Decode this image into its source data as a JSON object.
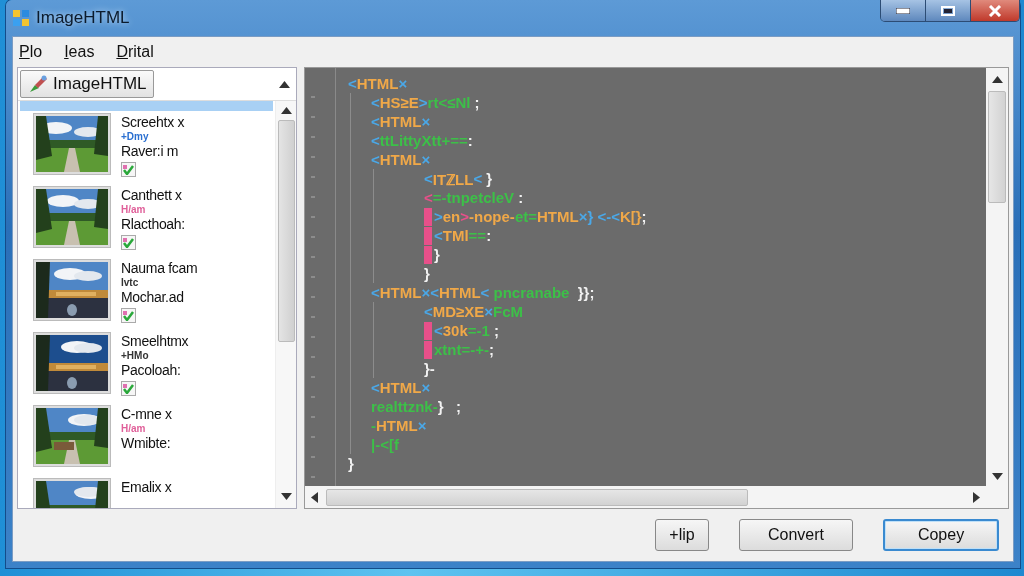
{
  "window": {
    "title": "ImageHTML"
  },
  "menu": [
    {
      "label": "Plo"
    },
    {
      "label": "Ieas"
    },
    {
      "label": "Drital"
    }
  ],
  "sidebar": {
    "header_button": "ImageHTML",
    "items": [
      {
        "title": "Screehtx x",
        "subtitle": {
          "text": "+Dmy",
          "color": "#2a6fd0"
        },
        "label": "Raver:i m",
        "checked": true
      },
      {
        "title": "Canthett x",
        "subtitle": {
          "text": "H/am",
          "color": "#e0609a"
        },
        "label": "Rlacthoah:",
        "checked": true
      },
      {
        "title": "Nauma fcam",
        "subtitle": {
          "text": "Ivtc",
          "color": "#333333"
        },
        "label": "Mochar.ad",
        "checked": true
      },
      {
        "title": "Smeelhtmx",
        "subtitle": {
          "text": "+HMo",
          "color": "#333333"
        },
        "label": "Pacoloah:",
        "checked": true
      },
      {
        "title": "C-mne x",
        "subtitle": {
          "text": "H/am",
          "color": "#e0609a"
        },
        "label": "Wmibte:"
      },
      {
        "title": "Emalix x"
      }
    ]
  },
  "code": {
    "lines": [
      {
        "segments": [
          {
            "text": "<",
            "kind": "br"
          },
          {
            "text": "HTML",
            "kind": "tag"
          },
          {
            "text": "×",
            "kind": "br"
          }
        ],
        "children": [
          {
            "segments": [
              {
                "text": "<",
                "kind": "br"
              },
              {
                "text": "HS≥E",
                "kind": "tag"
              },
              {
                "text": ">",
                "kind": "br"
              },
              {
                "text": "rt<≤Nl",
                "kind": "val"
              },
              {
                "text": " ;",
                "kind": "pun"
              }
            ]
          },
          {
            "segments": [
              {
                "text": "<",
                "kind": "br"
              },
              {
                "text": "HTML",
                "kind": "tag"
              },
              {
                "text": "×",
                "kind": "br"
              }
            ]
          },
          {
            "segments": [
              {
                "text": "<",
                "kind": "br"
              },
              {
                "text": "ttLittyXtt+==",
                "kind": "val"
              },
              {
                "text": ":",
                "kind": "pun"
              }
            ]
          },
          {
            "segments": [
              {
                "text": "<",
                "kind": "br"
              },
              {
                "text": "HTML",
                "kind": "tag"
              },
              {
                "text": "×",
                "kind": "br"
              }
            ],
            "children": [
              {
                "segments": [
                  {
                    "text": "<",
                    "kind": "br"
                  },
                  {
                    "text": "ITℤLL",
                    "kind": "tag"
                  },
                  {
                    "text": "<",
                    "kind": "br"
                  },
                  {
                    "text": " }",
                    "kind": "pun"
                  }
                ]
              },
              {
                "segments": [
                  {
                    "text": "<",
                    "kind": "mk"
                  },
                  {
                    "text": "=-tnpetcleV",
                    "kind": "val"
                  },
                  {
                    "text": " :",
                    "kind": "pun"
                  }
                ]
              },
              {
                "marker": true,
                "segments": [
                  {
                    "text": ">",
                    "kind": "br"
                  },
                  {
                    "text": "en",
                    "kind": "tag"
                  },
                  {
                    "text": ">",
                    "kind": "mk"
                  },
                  {
                    "text": "-nope-",
                    "kind": "tag"
                  },
                  {
                    "text": "et=",
                    "kind": "val"
                  },
                  {
                    "text": "HTML",
                    "kind": "tag"
                  },
                  {
                    "text": "×}",
                    "kind": "br"
                  },
                  {
                    "text": " <-<",
                    "kind": "br"
                  },
                  {
                    "text": "K[}",
                    "kind": "tag"
                  },
                  {
                    "text": ";",
                    "kind": "pun"
                  }
                ]
              },
              {
                "marker": true,
                "segments": [
                  {
                    "text": "<",
                    "kind": "br"
                  },
                  {
                    "text": "TMl",
                    "kind": "tag"
                  },
                  {
                    "text": "==",
                    "kind": "val"
                  },
                  {
                    "text": ":",
                    "kind": "pun"
                  }
                ]
              },
              {
                "marker": true,
                "segments": [
                  {
                    "text": "}",
                    "kind": "pun"
                  }
                ]
              },
              {
                "segments": [
                  {
                    "text": "}",
                    "kind": "pun"
                  }
                ]
              }
            ]
          },
          {
            "segments": [
              {
                "text": "<",
                "kind": "br"
              },
              {
                "text": "HTML",
                "kind": "tag"
              },
              {
                "text": "×<",
                "kind": "br"
              },
              {
                "text": "HTML",
                "kind": "tag"
              },
              {
                "text": "<",
                "kind": "br"
              },
              {
                "text": " pncranabe",
                "kind": "val"
              },
              {
                "text": "  }};",
                "kind": "pun"
              }
            ],
            "children": [
              {
                "segments": [
                  {
                    "text": "<",
                    "kind": "br"
                  },
                  {
                    "text": "MD≥XE",
                    "kind": "tag"
                  },
                  {
                    "text": "×",
                    "kind": "br"
                  },
                  {
                    "text": "FcM",
                    "kind": "val"
                  }
                ]
              },
              {
                "marker": true,
                "segments": [
                  {
                    "text": "<",
                    "kind": "br"
                  },
                  {
                    "text": "30k",
                    "kind": "tag"
                  },
                  {
                    "text": "=-1",
                    "kind": "val"
                  },
                  {
                    "text": " ;",
                    "kind": "pun"
                  }
                ]
              },
              {
                "marker": true,
                "segments": [
                  {
                    "text": "xtnt=-+-",
                    "kind": "val"
                  },
                  {
                    "text": ";",
                    "kind": "pun"
                  }
                ]
              },
              {
                "segments": [
                  {
                    "text": "}-",
                    "kind": "pun"
                  }
                ]
              }
            ]
          },
          {
            "segments": [
              {
                "text": "<",
                "kind": "br"
              },
              {
                "text": "HTML",
                "kind": "tag"
              },
              {
                "text": "×",
                "kind": "br"
              }
            ]
          },
          {
            "segments": [
              {
                "text": "realttznk-",
                "kind": "val"
              },
              {
                "text": "}   ;",
                "kind": "pun"
              }
            ]
          },
          {
            "segments": [
              {
                "text": "-",
                "kind": "val"
              },
              {
                "text": "HTML",
                "kind": "tag"
              },
              {
                "text": "×",
                "kind": "br"
              }
            ]
          },
          {
            "segments": [
              {
                "text": "|-<[f",
                "kind": "val"
              }
            ]
          }
        ]
      },
      {
        "segments": [
          {
            "text": "}",
            "kind": "pun"
          }
        ]
      }
    ]
  },
  "buttons": [
    {
      "label": "+lip",
      "focused": false
    },
    {
      "label": "Convert",
      "focused": false
    },
    {
      "label": "Copey",
      "focused": true
    }
  ]
}
